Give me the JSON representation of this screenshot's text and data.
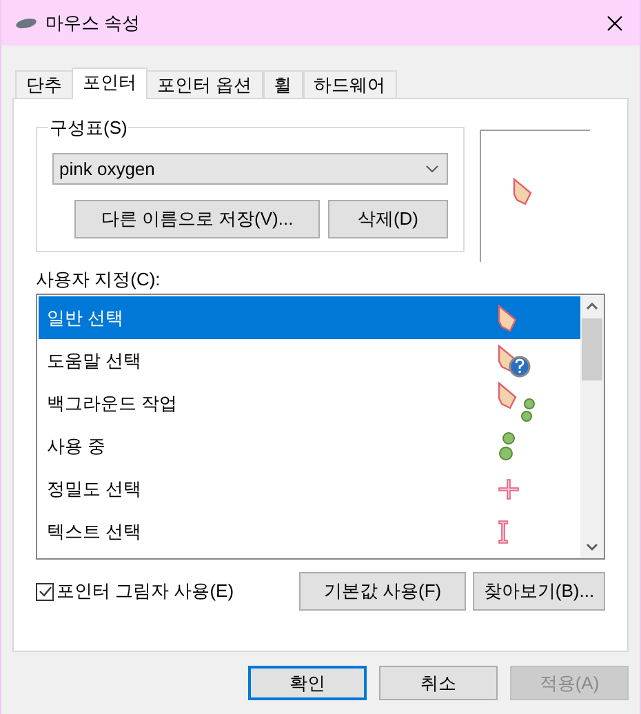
{
  "window": {
    "title": "마우스 속성"
  },
  "tabs": [
    {
      "label": "단추",
      "selected": false
    },
    {
      "label": "포인터",
      "selected": true
    },
    {
      "label": "포인터 옵션",
      "selected": false
    },
    {
      "label": "휠",
      "selected": false
    },
    {
      "label": "하드웨어",
      "selected": false
    }
  ],
  "scheme": {
    "label": "구성표(S)",
    "value": "pink oxygen",
    "buttons": [
      "다른 이름으로 저장(V)...",
      "삭제(D)"
    ]
  },
  "customize": {
    "label": "사용자 지정(C):",
    "items": [
      {
        "name": "일반 선택",
        "kind": "arrow",
        "selected": true
      },
      {
        "name": "도움말 선택",
        "kind": "help",
        "selected": false
      },
      {
        "name": "백그라운드 작업",
        "kind": "background",
        "selected": false
      },
      {
        "name": "사용 중",
        "kind": "busy",
        "selected": false
      },
      {
        "name": "정밀도 선택",
        "kind": "precision",
        "selected": false
      },
      {
        "name": "텍스트 선택",
        "kind": "text",
        "selected": false
      }
    ]
  },
  "shadow": {
    "label": "포인터 그림자 사용(E)",
    "checked": true
  },
  "panel_buttons": [
    "기본값 사용(F)",
    "찾아보기(B)..."
  ],
  "footer_buttons": [
    {
      "label": "확인",
      "default": true,
      "disabled": false
    },
    {
      "label": "취소",
      "default": false,
      "disabled": false
    },
    {
      "label": "적용(A)",
      "default": false,
      "disabled": true
    }
  ]
}
